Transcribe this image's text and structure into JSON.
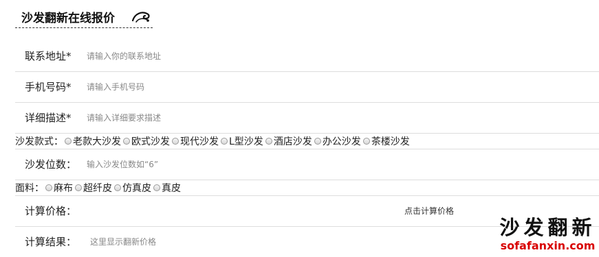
{
  "header": {
    "title": "沙发翻新在线报价",
    "icon": "sofa-swirl-icon"
  },
  "form": {
    "address": {
      "label": "联系地址*",
      "placeholder": "请输入你的联系地址"
    },
    "phone": {
      "label": "手机号码*",
      "placeholder": "请输入手机号码"
    },
    "description": {
      "label": "详细描述*",
      "placeholder": "请输入详细要求描述"
    },
    "style": {
      "label": "沙发款式：",
      "options": [
        "老款大沙发",
        "欧式沙发",
        "现代沙发",
        "L型沙发",
        "酒店沙发",
        "办公沙发",
        "茶楼沙发"
      ]
    },
    "seats": {
      "label": "沙发位数：",
      "placeholder": "输入沙发位数如“6”"
    },
    "material": {
      "label": "面料：",
      "options": [
        "麻布",
        "超纤皮",
        "仿真皮",
        "真皮"
      ]
    },
    "calc": {
      "label": "计算价格：",
      "button": "点击计算价格"
    },
    "result": {
      "label": "计算结果：",
      "value": "这里显示翻新价格"
    }
  },
  "watermark": {
    "cn": "沙发翻新",
    "en": "sofafanxin.com"
  }
}
